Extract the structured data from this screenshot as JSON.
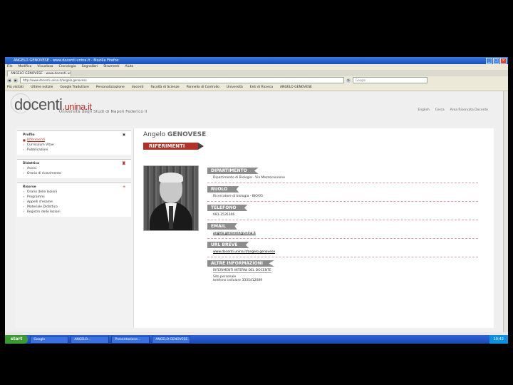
{
  "window": {
    "title": "ANGELO GENOVESE - www.docenti.unina.it - Mozilla Firefox",
    "buttons": [
      "_",
      "□",
      "×"
    ]
  },
  "menubar": [
    "File",
    "Modifica",
    "Visualizza",
    "Cronologia",
    "Segnalibri",
    "Strumenti",
    "Aiuto"
  ],
  "tab": {
    "label": "ANGELO GENOVESE - www.docenti.unina.it"
  },
  "navbar": {
    "url": "http://www.docenti.unina.it/angelo.genovese",
    "search_placeholder": "Google"
  },
  "bookmarks": [
    "Più visitati",
    "Ultime notizie",
    "Google Traduttore",
    "Personalizzazione",
    "docenti",
    "Facoltà di Scienze",
    "Pannello di Controllo",
    "Università",
    "Enti di Ricerca",
    "ANGELO GENOVESE"
  ],
  "site": {
    "logo_main": "docenti",
    "logo_suffix": ".unina.it",
    "logo_sub": "Università degli Studi di Napoli Federico II",
    "header_links": [
      "English",
      "Cerca",
      "Area Riservata Docente"
    ]
  },
  "sidebar": {
    "profilo": {
      "title": "Profilo",
      "items": [
        "Riferimenti",
        "Curriculum Vitae",
        "Pubblicazioni"
      ]
    },
    "didattica": {
      "title": "Didattica",
      "items": [
        "Avvisi",
        "Orario di ricevimento"
      ]
    },
    "risorse": {
      "title": "Risorse",
      "items": [
        "Orario delle lezioni",
        "Programmi",
        "Appelli d'esame",
        "Materiale Didattico",
        "Registro delle lezioni"
      ]
    }
  },
  "profile": {
    "name_first": "Angelo",
    "name_last": "GENOVESE",
    "section": "RIFERIMENTI",
    "fields": [
      {
        "label": "DIPARTIMENTO",
        "value": "Dipartimento di Biologia - Via Mezzocannone"
      },
      {
        "label": "RUOLO",
        "value": "Ricercatore di biologia - BIO/05"
      },
      {
        "label": "TELEFONO",
        "value": "081-2535306"
      },
      {
        "label": "EMAIL",
        "value": "angelo.genovese@unina.it"
      },
      {
        "label": "URL BREVE",
        "value": "www.docenti.unina.it/angelo.genovese"
      },
      {
        "label": "ALTRE INFORMAZIONI",
        "value": "RIFERIMENTI INTERNI DEL DOCENTE",
        "extra": [
          "Sito personale",
          "telefono cellulare 3335412089"
        ]
      }
    ]
  },
  "taskbar": {
    "start": "start",
    "items": [
      "Google",
      "ANGELO...",
      "Presentazione...",
      "ANGELO GENOVESE..."
    ],
    "clock": "10:42"
  }
}
